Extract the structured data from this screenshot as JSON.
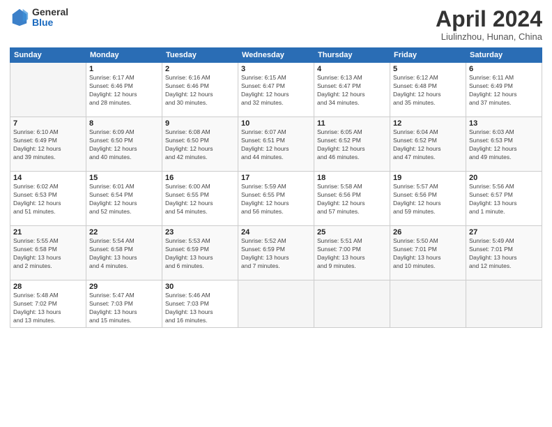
{
  "header": {
    "logo_general": "General",
    "logo_blue": "Blue",
    "title": "April 2024",
    "location": "Liulinzhou, Hunan, China"
  },
  "weekdays": [
    "Sunday",
    "Monday",
    "Tuesday",
    "Wednesday",
    "Thursday",
    "Friday",
    "Saturday"
  ],
  "weeks": [
    [
      {
        "day": "",
        "info": ""
      },
      {
        "day": "1",
        "info": "Sunrise: 6:17 AM\nSunset: 6:46 PM\nDaylight: 12 hours\nand 28 minutes."
      },
      {
        "day": "2",
        "info": "Sunrise: 6:16 AM\nSunset: 6:46 PM\nDaylight: 12 hours\nand 30 minutes."
      },
      {
        "day": "3",
        "info": "Sunrise: 6:15 AM\nSunset: 6:47 PM\nDaylight: 12 hours\nand 32 minutes."
      },
      {
        "day": "4",
        "info": "Sunrise: 6:13 AM\nSunset: 6:47 PM\nDaylight: 12 hours\nand 34 minutes."
      },
      {
        "day": "5",
        "info": "Sunrise: 6:12 AM\nSunset: 6:48 PM\nDaylight: 12 hours\nand 35 minutes."
      },
      {
        "day": "6",
        "info": "Sunrise: 6:11 AM\nSunset: 6:49 PM\nDaylight: 12 hours\nand 37 minutes."
      }
    ],
    [
      {
        "day": "7",
        "info": "Sunrise: 6:10 AM\nSunset: 6:49 PM\nDaylight: 12 hours\nand 39 minutes."
      },
      {
        "day": "8",
        "info": "Sunrise: 6:09 AM\nSunset: 6:50 PM\nDaylight: 12 hours\nand 40 minutes."
      },
      {
        "day": "9",
        "info": "Sunrise: 6:08 AM\nSunset: 6:50 PM\nDaylight: 12 hours\nand 42 minutes."
      },
      {
        "day": "10",
        "info": "Sunrise: 6:07 AM\nSunset: 6:51 PM\nDaylight: 12 hours\nand 44 minutes."
      },
      {
        "day": "11",
        "info": "Sunrise: 6:05 AM\nSunset: 6:52 PM\nDaylight: 12 hours\nand 46 minutes."
      },
      {
        "day": "12",
        "info": "Sunrise: 6:04 AM\nSunset: 6:52 PM\nDaylight: 12 hours\nand 47 minutes."
      },
      {
        "day": "13",
        "info": "Sunrise: 6:03 AM\nSunset: 6:53 PM\nDaylight: 12 hours\nand 49 minutes."
      }
    ],
    [
      {
        "day": "14",
        "info": "Sunrise: 6:02 AM\nSunset: 6:53 PM\nDaylight: 12 hours\nand 51 minutes."
      },
      {
        "day": "15",
        "info": "Sunrise: 6:01 AM\nSunset: 6:54 PM\nDaylight: 12 hours\nand 52 minutes."
      },
      {
        "day": "16",
        "info": "Sunrise: 6:00 AM\nSunset: 6:55 PM\nDaylight: 12 hours\nand 54 minutes."
      },
      {
        "day": "17",
        "info": "Sunrise: 5:59 AM\nSunset: 6:55 PM\nDaylight: 12 hours\nand 56 minutes."
      },
      {
        "day": "18",
        "info": "Sunrise: 5:58 AM\nSunset: 6:56 PM\nDaylight: 12 hours\nand 57 minutes."
      },
      {
        "day": "19",
        "info": "Sunrise: 5:57 AM\nSunset: 6:56 PM\nDaylight: 12 hours\nand 59 minutes."
      },
      {
        "day": "20",
        "info": "Sunrise: 5:56 AM\nSunset: 6:57 PM\nDaylight: 13 hours\nand 1 minute."
      }
    ],
    [
      {
        "day": "21",
        "info": "Sunrise: 5:55 AM\nSunset: 6:58 PM\nDaylight: 13 hours\nand 2 minutes."
      },
      {
        "day": "22",
        "info": "Sunrise: 5:54 AM\nSunset: 6:58 PM\nDaylight: 13 hours\nand 4 minutes."
      },
      {
        "day": "23",
        "info": "Sunrise: 5:53 AM\nSunset: 6:59 PM\nDaylight: 13 hours\nand 6 minutes."
      },
      {
        "day": "24",
        "info": "Sunrise: 5:52 AM\nSunset: 6:59 PM\nDaylight: 13 hours\nand 7 minutes."
      },
      {
        "day": "25",
        "info": "Sunrise: 5:51 AM\nSunset: 7:00 PM\nDaylight: 13 hours\nand 9 minutes."
      },
      {
        "day": "26",
        "info": "Sunrise: 5:50 AM\nSunset: 7:01 PM\nDaylight: 13 hours\nand 10 minutes."
      },
      {
        "day": "27",
        "info": "Sunrise: 5:49 AM\nSunset: 7:01 PM\nDaylight: 13 hours\nand 12 minutes."
      }
    ],
    [
      {
        "day": "28",
        "info": "Sunrise: 5:48 AM\nSunset: 7:02 PM\nDaylight: 13 hours\nand 13 minutes."
      },
      {
        "day": "29",
        "info": "Sunrise: 5:47 AM\nSunset: 7:03 PM\nDaylight: 13 hours\nand 15 minutes."
      },
      {
        "day": "30",
        "info": "Sunrise: 5:46 AM\nSunset: 7:03 PM\nDaylight: 13 hours\nand 16 minutes."
      },
      {
        "day": "",
        "info": ""
      },
      {
        "day": "",
        "info": ""
      },
      {
        "day": "",
        "info": ""
      },
      {
        "day": "",
        "info": ""
      }
    ]
  ]
}
